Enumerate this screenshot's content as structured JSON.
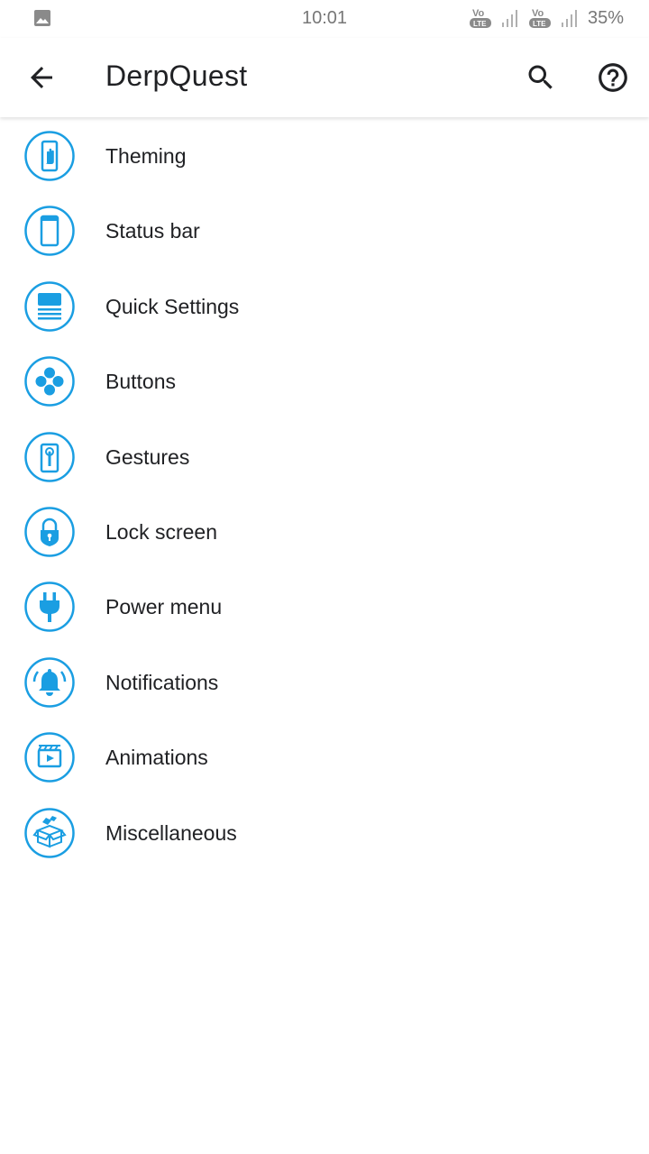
{
  "status_bar": {
    "time": "10:01",
    "battery": "35%",
    "volte_label_top": "Vo",
    "volte_label_bottom": "LTE",
    "icons": [
      "gallery-icon",
      "volte-icon",
      "signal-icon",
      "volte-icon",
      "signal-icon"
    ]
  },
  "app_bar": {
    "title": "DerpQuest",
    "icons": [
      "back-arrow-icon",
      "search-icon",
      "help-icon"
    ]
  },
  "colors": {
    "accent": "#1a9ee2",
    "text_primary": "#202124",
    "status_text": "#777777",
    "background": "#ffffff"
  },
  "settings": {
    "items": [
      {
        "label": "Theming",
        "icon": "theming-icon"
      },
      {
        "label": "Status bar",
        "icon": "status-bar-icon"
      },
      {
        "label": "Quick Settings",
        "icon": "quick-settings-icon"
      },
      {
        "label": "Buttons",
        "icon": "buttons-icon"
      },
      {
        "label": "Gestures",
        "icon": "gestures-icon"
      },
      {
        "label": "Lock screen",
        "icon": "lock-screen-icon"
      },
      {
        "label": "Power menu",
        "icon": "power-menu-icon"
      },
      {
        "label": "Notifications",
        "icon": "notifications-icon"
      },
      {
        "label": "Animations",
        "icon": "animations-icon"
      },
      {
        "label": "Miscellaneous",
        "icon": "miscellaneous-icon"
      }
    ]
  }
}
